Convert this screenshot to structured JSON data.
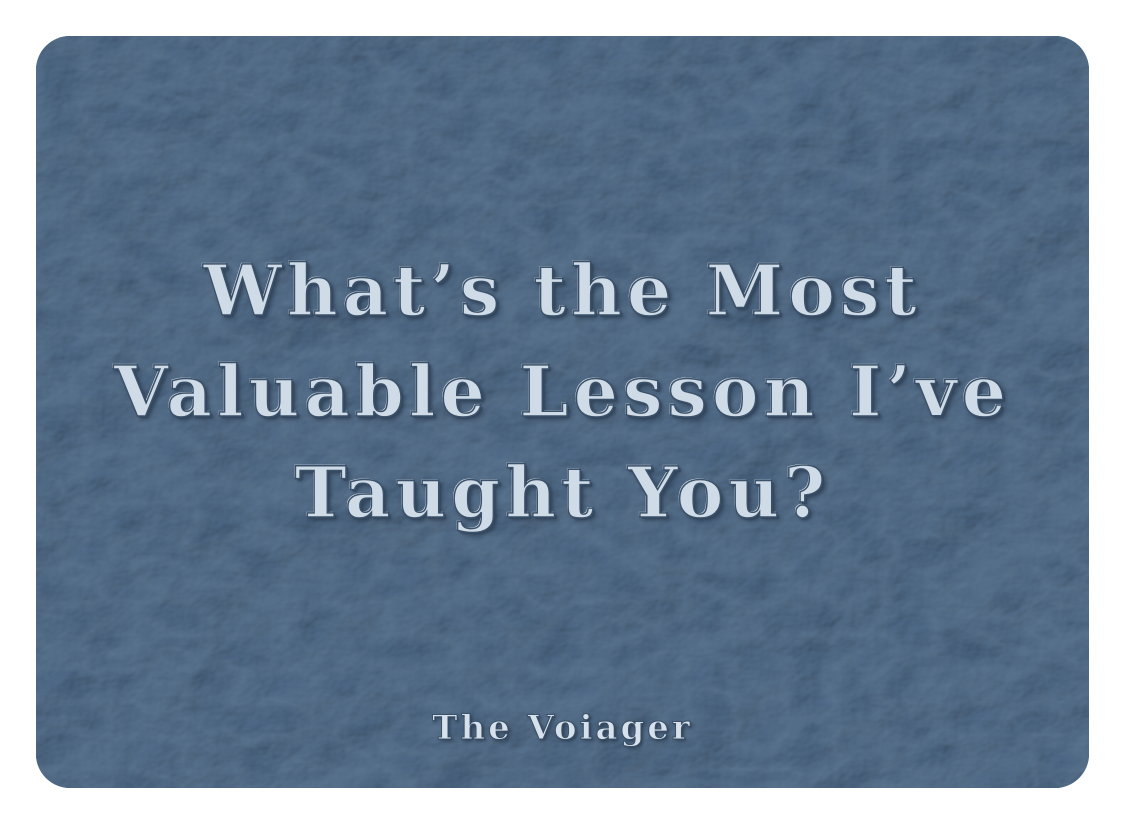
{
  "card": {
    "background_color": "#5f7891",
    "text_color": "#cfdbe6",
    "outline_color": "#3a5169",
    "page_background": "#ffffff"
  },
  "headline": {
    "line1": "What’s the Most",
    "line2": "Valuable Lesson I’ve",
    "line3": "Taught You?"
  },
  "signature": "The Voiager"
}
